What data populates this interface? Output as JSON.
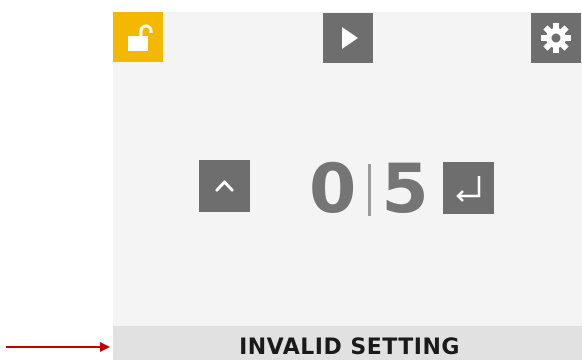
{
  "status": {
    "message": "INVALID SETTING"
  },
  "display": {
    "digit_left": "0",
    "digit_right": "5"
  },
  "toolbar": {
    "lock_icon": "unlock-icon",
    "play_icon": "play-icon",
    "settings_icon": "gear-icon"
  },
  "controls": {
    "up_icon": "chevron-up-icon",
    "enter_icon": "enter-return-icon"
  },
  "colors": {
    "accent": "#f5b800",
    "button_gray": "#6e6e6e",
    "screen_bg": "#f4f4f4",
    "status_bg": "#e1e1e1",
    "digit_color": "#757575",
    "arrow_red": "#c00000"
  }
}
